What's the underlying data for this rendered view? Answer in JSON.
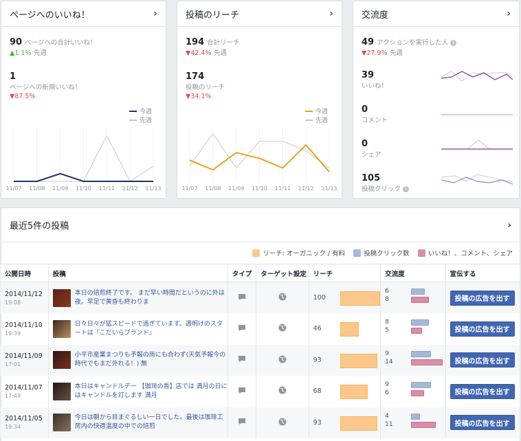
{
  "likes_card": {
    "title": "ページへのいいね！",
    "total_value": "90",
    "total_label": "ページへの合計いいね！",
    "total_change": "1.1%",
    "total_change_suffix": "先週",
    "new_value": "1",
    "new_label": "ページへの新規いいね！",
    "new_change": "87.5%",
    "legend_this_week": "今週",
    "legend_last_week": "先週",
    "x_labels": [
      "11/07",
      "11/08",
      "11/09",
      "11/10",
      "11/11",
      "11/12",
      "11/13"
    ]
  },
  "reach_card": {
    "title": "投稿のリーチ",
    "total_value": "194",
    "total_label": "合計リーチ",
    "total_change": "42.4%",
    "total_change_suffix": "先週",
    "post_value": "174",
    "post_label": "投稿のリーチ",
    "post_change": "34.1%",
    "legend_this_week": "今週",
    "legend_last_week": "先週",
    "x_labels": [
      "11/07",
      "11/08",
      "11/09",
      "11/10",
      "11/11",
      "11/12",
      "11/13"
    ]
  },
  "engagement_card": {
    "title": "交流度",
    "total_value": "49",
    "total_label": "アクションを実行した人",
    "total_change": "27.9%",
    "total_change_suffix": "先週",
    "rows": [
      {
        "value": "39",
        "label": "いいね！"
      },
      {
        "value": "0",
        "label": "コメント"
      },
      {
        "value": "0",
        "label": "シェア"
      },
      {
        "value": "105",
        "label": "投稿クリック"
      }
    ]
  },
  "recent_posts": {
    "title": "最近5件の投稿",
    "legend": {
      "reach": "リーチ: オーガニック / 有料",
      "clicks": "投稿クリック数",
      "likes": "いいね！、コメント、シェア"
    },
    "headers": {
      "date": "公開日時",
      "post": "投稿",
      "type": "タイプ",
      "target": "ターゲット設定",
      "reach": "リーチ",
      "engagement": "交流度",
      "promote": "宣伝する"
    },
    "boost_label": "投稿の広告を出す",
    "posts": [
      {
        "date": "2014/11/12",
        "time": "19:08",
        "text": "本日の焙煎終了です。 まだ早い時間だというのに外は夜。早足で黄昏も終わりま",
        "reach": "100",
        "clicks": "6",
        "likes": "8"
      },
      {
        "date": "2014/11/10",
        "time": "19:39",
        "text": "日々日々が猛スピードで過ぎています。週明けのスタートは『こだいらブランド』",
        "reach": "46",
        "clicks": "8",
        "likes": "5"
      },
      {
        "date": "2014/11/09",
        "time": "17:01",
        "text": "小平市産業まつりも予報の雨にも合わず(天気予報今の時代でもまだ外れる！) 無",
        "reach": "93",
        "clicks": "9",
        "likes": "14"
      },
      {
        "date": "2014/11/07",
        "time": "17:49",
        "text": "本日はキャンドルデー 【珈琲の香】店では 満月の日にはキャンドルを灯します 満月",
        "reach": "68",
        "clicks": "9",
        "likes": "6"
      },
      {
        "date": "2014/11/05",
        "time": "19:34",
        "text": "今日は朝から目まぐるしい一日でした。最後は珈琲工房内の快適温度の中での焙煎",
        "reach": "93",
        "clicks": "4",
        "likes": "11"
      }
    ]
  },
  "colors": {
    "this_week_likes": "#1f3264",
    "this_week_reach": "#e6a220",
    "last_week": "#c8c8c8",
    "reach_bar": "#fcc78a",
    "clicks_bar": "#a7b8d6",
    "likes_bar": "#d98ea6",
    "boost_button": "#4267b2"
  },
  "chart_data": [
    {
      "type": "line",
      "x": [
        "11/07",
        "11/08",
        "11/09",
        "11/10",
        "11/11",
        "11/12",
        "11/13"
      ],
      "series": [
        {
          "name": "今週",
          "values": [
            0,
            0,
            1,
            0,
            0,
            0,
            0
          ]
        },
        {
          "name": "先週",
          "values": [
            0,
            0,
            0,
            0,
            6,
            0,
            2
          ]
        }
      ],
      "ylim": [
        0,
        7
      ]
    },
    {
      "type": "line",
      "x": [
        "11/07",
        "11/08",
        "11/09",
        "11/10",
        "11/11",
        "11/12",
        "11/13"
      ],
      "series": [
        {
          "name": "今週",
          "values": [
            55,
            30,
            75,
            60,
            35,
            95,
            25
          ]
        },
        {
          "name": "先週",
          "values": [
            40,
            125,
            35,
            105,
            105,
            80,
            35
          ]
        }
      ],
      "ylim": [
        0,
        140
      ]
    }
  ]
}
